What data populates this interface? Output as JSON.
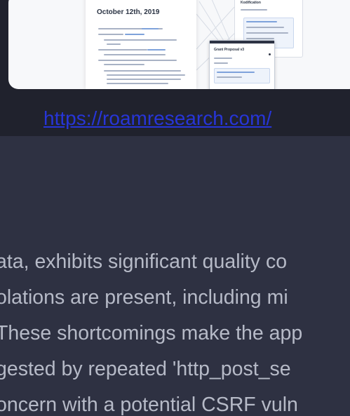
{
  "preview": {
    "doc_title": "October 12th, 2019",
    "side_panel_title": "Kodification",
    "float_panel_title": "Grant Proposal v3"
  },
  "link": {
    "text": "https://roamresearch.com/"
  },
  "body_text": {
    "lines": [
      "ata, exhibits significant quality co",
      "olations are present, including mi",
      "These shortcomings make the app",
      "gested by repeated 'http_post_se",
      "oncern with a potential CSRF vuln"
    ]
  },
  "colors": {
    "background": "#2e3142",
    "top_band": "#20222d",
    "link": "#2735d8",
    "text": "#b6bac7"
  }
}
